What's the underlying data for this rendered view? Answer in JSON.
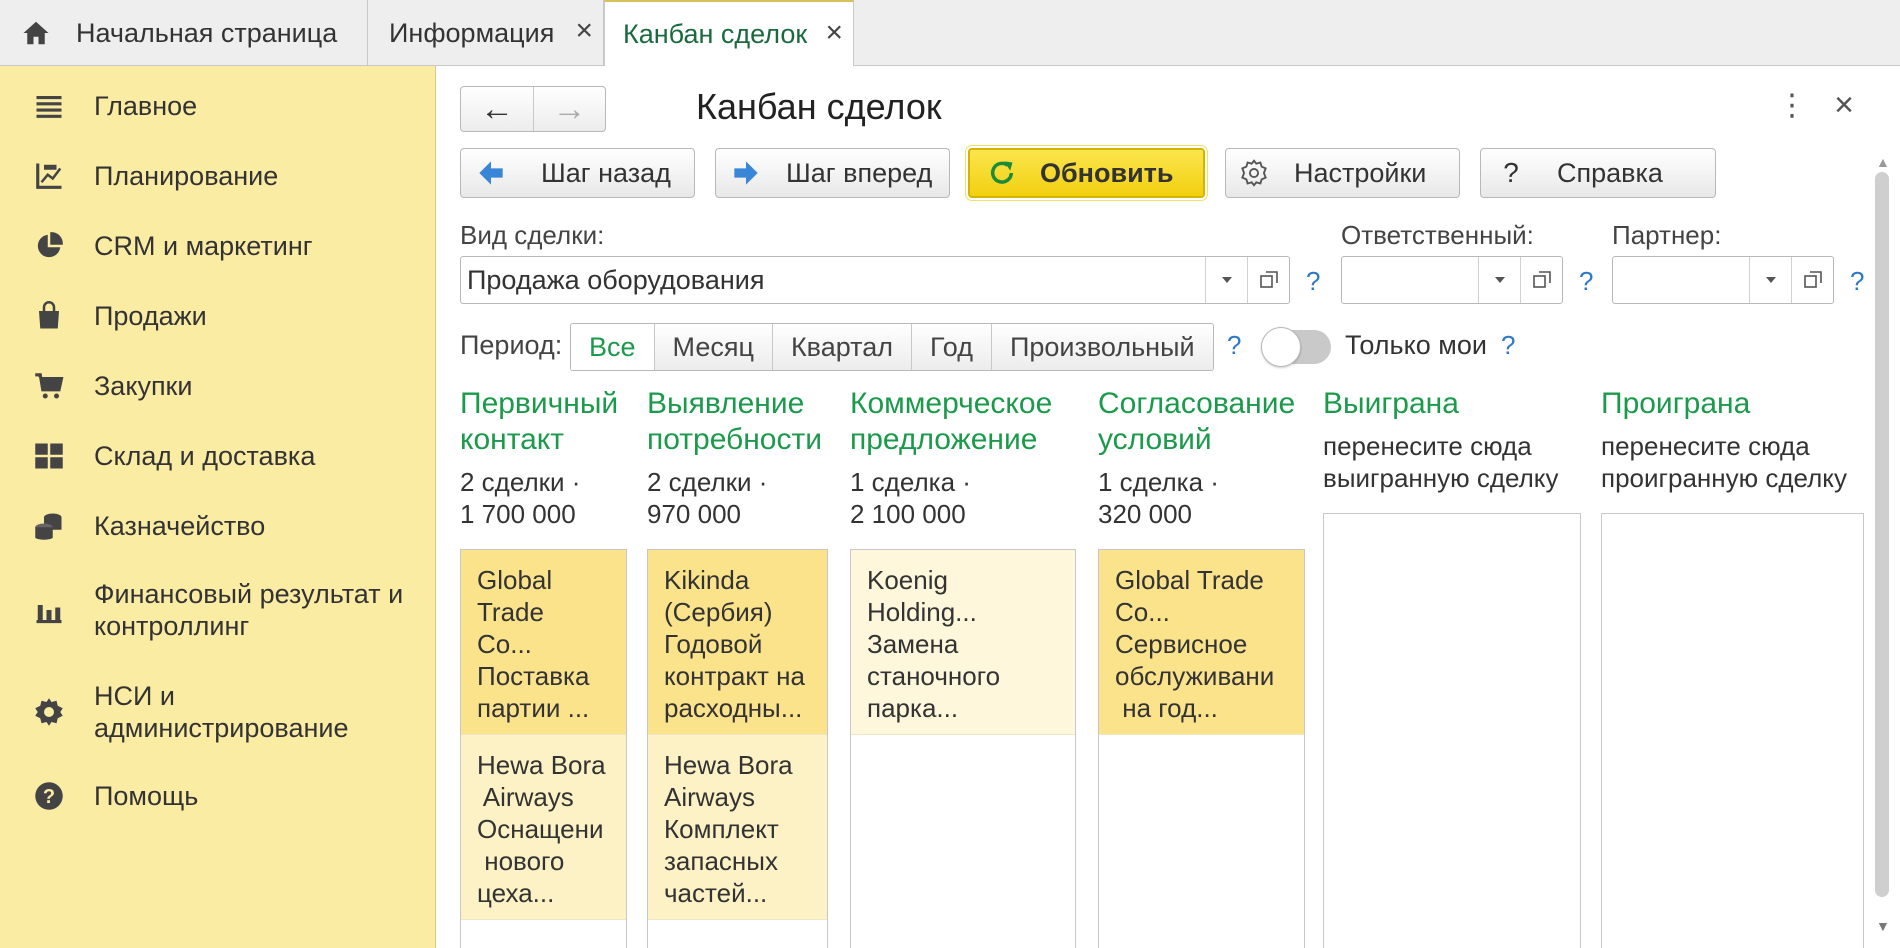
{
  "tabs": [
    {
      "label": "Начальная страница"
    },
    {
      "label": "Информация",
      "close": "×"
    },
    {
      "label": "Канбан сделок",
      "close": "×"
    }
  ],
  "sidebar": {
    "items": [
      {
        "label": "Главное",
        "icon": "menu-icon"
      },
      {
        "label": "Планирование",
        "icon": "planning-icon"
      },
      {
        "label": "CRM и маркетинг",
        "icon": "pie-chart-icon"
      },
      {
        "label": "Продажи",
        "icon": "shopping-bag-icon"
      },
      {
        "label": "Закупки",
        "icon": "cart-icon"
      },
      {
        "label": "Склад и доставка",
        "icon": "warehouse-grid-icon"
      },
      {
        "label": "Казначейство",
        "icon": "coins-icon"
      },
      {
        "label": "Финансовый результат и контроллинг",
        "icon": "bar-chart-icon"
      },
      {
        "label": "НСИ и администрирование",
        "icon": "gear-icon"
      },
      {
        "label": "Помощь",
        "icon": "help-icon"
      }
    ]
  },
  "form": {
    "title": "Канбан сделок",
    "more": "⋮",
    "close": "×",
    "nav_back": "←",
    "nav_forward": "→"
  },
  "toolbar": {
    "back_label": "Шаг назад",
    "forward_label": "Шаг вперед",
    "refresh_label": "Обновить",
    "settings_label": "Настройки",
    "help_label": "Справка",
    "help_icon_glyph": "?"
  },
  "filters": {
    "deal_type_label": "Вид сделки:",
    "deal_type_value": "Продажа оборудования",
    "responsible_label": "Ответственный:",
    "responsible_value": "",
    "partner_label": "Партнер:",
    "partner_value": "",
    "help_mark": "?"
  },
  "period": {
    "label": "Период:",
    "options": [
      "Все",
      "Месяц",
      "Квартал",
      "Год",
      "Произвольный"
    ],
    "selected": "Все",
    "only_mine_label": "Только мои",
    "only_mine_on": false
  },
  "columns": [
    {
      "title": "Первичный контакт",
      "title_lines": [
        "Первичный",
        "контакт"
      ],
      "count": "2 сделки ·",
      "sum": "1 700 000",
      "cards": [
        {
          "lines": [
            "Global",
            "Trade",
            "Co...",
            "Поставка",
            "партии ..."
          ]
        },
        {
          "lines": [
            "Hewa Bora",
            " Airways",
            "Оснащени",
            " нового",
            "цеха..."
          ]
        }
      ]
    },
    {
      "title": "Выявление потребности",
      "title_lines": [
        "Выявление",
        "потребности"
      ],
      "count": "2 сделки ·",
      "sum": "970 000",
      "cards": [
        {
          "lines": [
            "Kikinda",
            "(Сербия)",
            "Годовой",
            "контракт на",
            "расходны..."
          ]
        },
        {
          "lines": [
            "Hewa Bora",
            "Airways",
            "Комплект",
            "запасных",
            "частей..."
          ]
        }
      ]
    },
    {
      "title": "Коммерческое предложение",
      "title_lines": [
        "Коммерческое",
        "предложение"
      ],
      "count": "1 сделка ·",
      "sum": "2 100 000",
      "cards": [
        {
          "lines": [
            "Koenig",
            "Holding...",
            "Замена",
            "станочного",
            "парка..."
          ]
        }
      ]
    },
    {
      "title": "Согласование условий",
      "title_lines": [
        "Согласование",
        "условий"
      ],
      "count": "1 сделка ·",
      "sum": "320 000",
      "cards": [
        {
          "lines": [
            "Global Trade",
            "Co...",
            "Сервисное",
            "обслуживани",
            " на год..."
          ]
        }
      ]
    },
    {
      "title": "Выиграна",
      "hint_lines": [
        "перенесите сюда",
        "выигранную сделку"
      ]
    },
    {
      "title": "Проиграна",
      "hint_lines": [
        "перенесите сюда",
        "проигранную сделку"
      ]
    }
  ],
  "colors": {
    "sidebar_bg": "#fbeca4",
    "accent_green": "#1b9a4b",
    "refresh_yellow": "#f2cf10",
    "card_dark": "#fbe38c",
    "card_light": "#fdf2c5",
    "help_blue": "#2e79c7"
  }
}
